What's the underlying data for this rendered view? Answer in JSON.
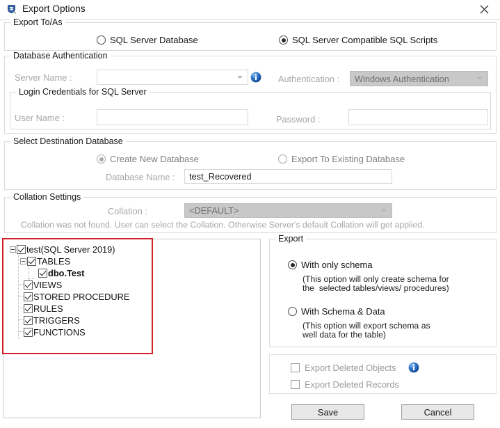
{
  "window": {
    "title": "Export Options",
    "icon": "app-shield-icon",
    "close_label": "✕"
  },
  "export_to_as": {
    "legend": "Export To/As",
    "options": [
      {
        "label": "SQL Server Database",
        "checked": false
      },
      {
        "label": "SQL Server Compatible SQL Scripts",
        "checked": true
      }
    ]
  },
  "database_authentication": {
    "legend": "Database Authentication",
    "server_name_label": "Server Name :",
    "server_name_value": "",
    "info_icon": "info-icon",
    "authentication_label": "Authentication :",
    "authentication_value": "Windows Authentication",
    "login_credentials": {
      "legend": "Login Credentials for SQL Server",
      "user_name_label": "User Name :",
      "user_name_value": "",
      "password_label": "Password :",
      "password_value": ""
    }
  },
  "select_destination_database": {
    "legend": "Select Destination Database",
    "options": [
      {
        "label": "Create New Database",
        "checked": true
      },
      {
        "label": "Export To Existing Database",
        "checked": false
      }
    ],
    "database_name_label": "Database Name :",
    "database_name_value": "test_Recovered"
  },
  "collation_settings": {
    "legend": "Collation Settings",
    "collation_label": "Collation :",
    "collation_value": "<DEFAULT>",
    "note": "Collation was not found. User can select the Collation. Otherwise Server's default Collation will get applied."
  },
  "tree": {
    "nodes": [
      {
        "label": "test(SQL Server 2019)",
        "depth": 0,
        "checked": true,
        "expanded": true,
        "bold": false
      },
      {
        "label": "TABLES",
        "depth": 1,
        "checked": true,
        "expanded": true,
        "bold": false
      },
      {
        "label": "dbo.Test",
        "depth": 2,
        "checked": true,
        "expanded": null,
        "bold": true
      },
      {
        "label": "VIEWS",
        "depth": 1,
        "checked": true,
        "expanded": null,
        "bold": false
      },
      {
        "label": "STORED PROCEDURE",
        "depth": 1,
        "checked": true,
        "expanded": null,
        "bold": false
      },
      {
        "label": "RULES",
        "depth": 1,
        "checked": true,
        "expanded": null,
        "bold": false
      },
      {
        "label": "TRIGGERS",
        "depth": 1,
        "checked": true,
        "expanded": null,
        "bold": false
      },
      {
        "label": "FUNCTIONS",
        "depth": 1,
        "checked": true,
        "expanded": null,
        "bold": false
      }
    ],
    "highlight_color": "#d32028"
  },
  "export_panel": {
    "legend": "Export",
    "option_schema_only": {
      "label": "With only schema",
      "checked": true,
      "description_line1": "(This option will only create schema for",
      "description_line2": "the  selected tables/views/ procedures)"
    },
    "option_schema_data": {
      "label": "With Schema & Data",
      "checked": false,
      "description_line1": "(This option will export schema as",
      "description_line2": "well data for the table)"
    }
  },
  "deleted_panel": {
    "export_deleted_objects": {
      "label": "Export Deleted Objects",
      "checked": false
    },
    "export_deleted_objects_info_icon": "info-icon",
    "export_deleted_records": {
      "label": "Export Deleted Records",
      "checked": false
    }
  },
  "actions": {
    "save_label": "Save",
    "cancel_label": "Cancel"
  }
}
